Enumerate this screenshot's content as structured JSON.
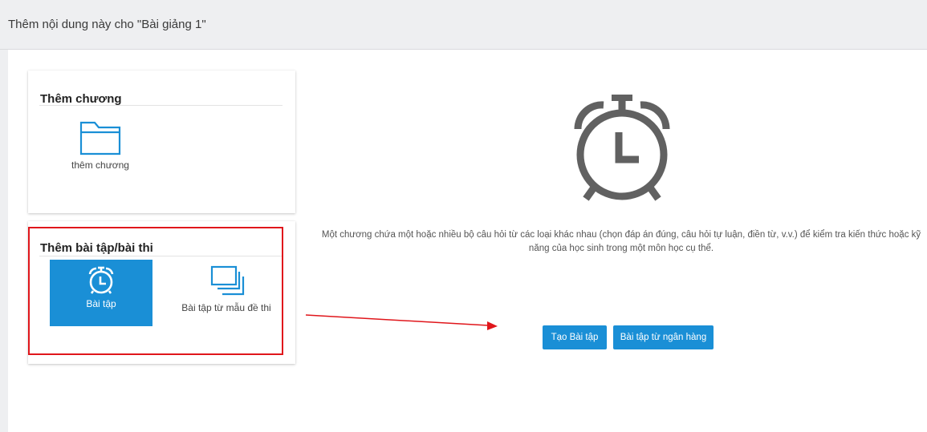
{
  "header": {
    "title": "Thêm nội dung này cho \"Bài giảng 1\""
  },
  "chapter_card": {
    "title": "Thêm chương",
    "tile_label": "thêm chương",
    "icon": "folder-icon"
  },
  "exercise_card": {
    "title": "Thêm bài tập/bài thi",
    "exercise_label": "Bài tập",
    "exercise_icon": "alarm-clock-icon",
    "template_label": "Bài tập từ mẫu đề thi",
    "template_icon": "stacked-squares-icon"
  },
  "detail": {
    "icon": "alarm-clock-icon",
    "description": "Một chương chứa một hoặc nhiều bộ câu hỏi từ các loại khác nhau (chọn đáp án đúng, câu hỏi tự luận, điền từ, v.v.) để kiểm tra kiến thức hoặc kỹ năng của học sinh trong một môn học cụ thể.",
    "create_button": "Tạo Bài tập",
    "bank_button": "Bài tập từ ngân hàng"
  },
  "colors": {
    "accent": "#1a8fd6",
    "annotation": "#e0161b",
    "icon_gray": "#616161"
  }
}
